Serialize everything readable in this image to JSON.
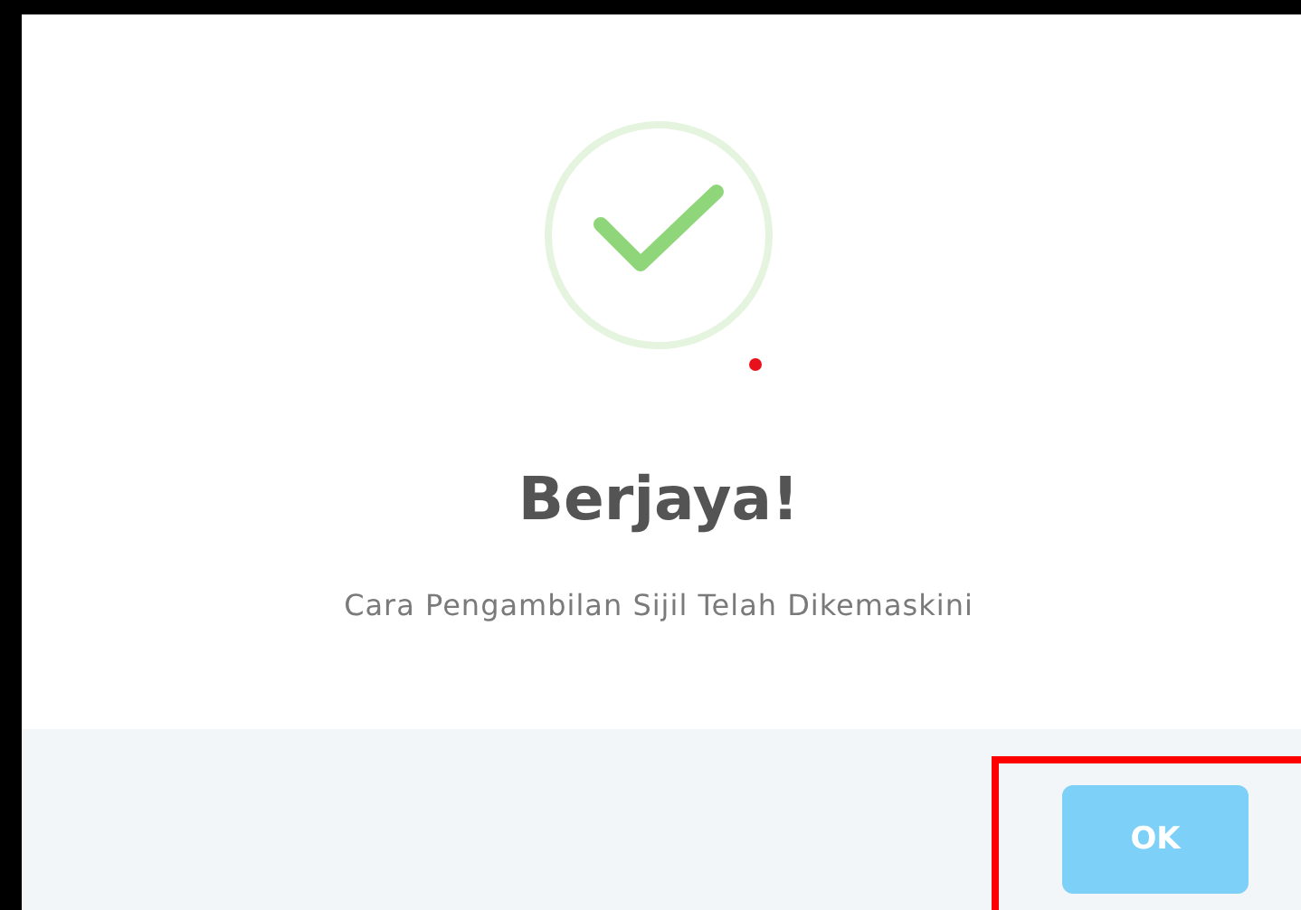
{
  "dialog": {
    "kind": "success",
    "title": "Berjaya!",
    "message": "Cara Pengambilan Sijil Telah Dikemaskini",
    "buttons": [
      {
        "label": "OK"
      }
    ]
  }
}
